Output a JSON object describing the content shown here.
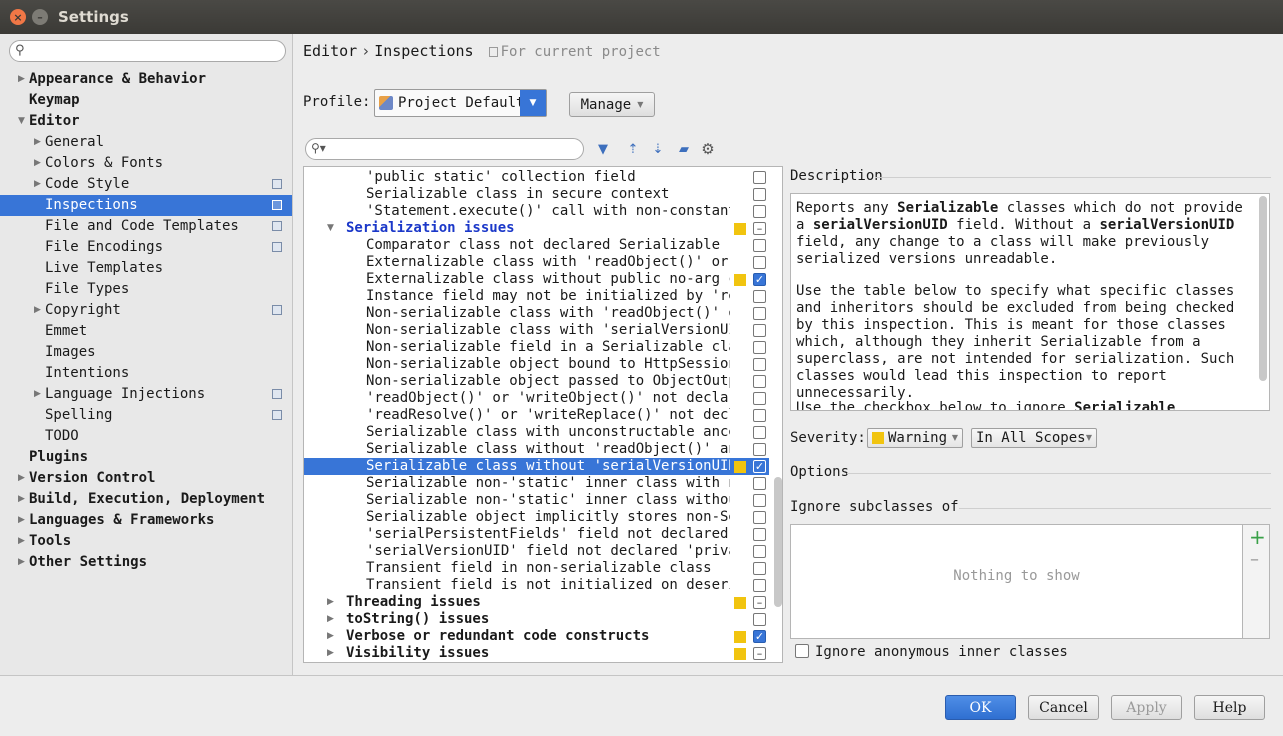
{
  "window": {
    "title": "Settings"
  },
  "sidebar": {
    "search_placeholder": "",
    "tree": [
      {
        "label": "Appearance & Behavior",
        "level": 0,
        "bold": true,
        "arrow": "right"
      },
      {
        "label": "Keymap",
        "level": 0,
        "bold": true,
        "arrow": ""
      },
      {
        "label": "Editor",
        "level": 0,
        "bold": true,
        "arrow": "down"
      },
      {
        "label": "General",
        "level": 1,
        "bold": false,
        "arrow": "right"
      },
      {
        "label": "Colors & Fonts",
        "level": 1,
        "bold": false,
        "arrow": "right"
      },
      {
        "label": "Code Style",
        "level": 1,
        "bold": false,
        "arrow": "right",
        "copy": true
      },
      {
        "label": "Inspections",
        "level": 1,
        "bold": false,
        "arrow": "",
        "copy": true,
        "selected": true
      },
      {
        "label": "File and Code Templates",
        "level": 1,
        "bold": false,
        "arrow": "",
        "copy": true
      },
      {
        "label": "File Encodings",
        "level": 1,
        "bold": false,
        "arrow": "",
        "copy": true
      },
      {
        "label": "Live Templates",
        "level": 1,
        "bold": false,
        "arrow": ""
      },
      {
        "label": "File Types",
        "level": 1,
        "bold": false,
        "arrow": ""
      },
      {
        "label": "Copyright",
        "level": 1,
        "bold": false,
        "arrow": "right",
        "copy": true
      },
      {
        "label": "Emmet",
        "level": 1,
        "bold": false,
        "arrow": ""
      },
      {
        "label": "Images",
        "level": 1,
        "bold": false,
        "arrow": ""
      },
      {
        "label": "Intentions",
        "level": 1,
        "bold": false,
        "arrow": ""
      },
      {
        "label": "Language Injections",
        "level": 1,
        "bold": false,
        "arrow": "right",
        "copy": true
      },
      {
        "label": "Spelling",
        "level": 1,
        "bold": false,
        "arrow": "",
        "copy": true
      },
      {
        "label": "TODO",
        "level": 1,
        "bold": false,
        "arrow": ""
      },
      {
        "label": "Plugins",
        "level": 0,
        "bold": true,
        "arrow": ""
      },
      {
        "label": "Version Control",
        "level": 0,
        "bold": true,
        "arrow": "right"
      },
      {
        "label": "Build, Execution, Deployment",
        "level": 0,
        "bold": true,
        "arrow": "right"
      },
      {
        "label": "Languages & Frameworks",
        "level": 0,
        "bold": true,
        "arrow": "right"
      },
      {
        "label": "Tools",
        "level": 0,
        "bold": true,
        "arrow": "right"
      },
      {
        "label": "Other Settings",
        "level": 0,
        "bold": true,
        "arrow": "right"
      }
    ]
  },
  "header": {
    "crumb1": "Editor",
    "sep": "›",
    "crumb2": "Inspections",
    "scope": "For current project"
  },
  "profile": {
    "label": "Profile:",
    "value": "Project Default",
    "manage": "Manage"
  },
  "inspections": [
    {
      "text": "'public static' collection field",
      "indent": 2,
      "cb": "empty"
    },
    {
      "text": "Serializable class in secure context",
      "indent": 2,
      "cb": "empty"
    },
    {
      "text": "'Statement.execute()' call with non-constant s",
      "indent": 2,
      "cb": "empty"
    },
    {
      "text": "Serialization issues",
      "indent": 1,
      "kind": "blue",
      "arrow": "down",
      "sev": "yellow",
      "cb": "partial"
    },
    {
      "text": "Comparator class not declared Serializable",
      "indent": 2,
      "cb": "empty"
    },
    {
      "text": "Externalizable class with 'readObject()' or 'w",
      "indent": 2,
      "cb": "empty"
    },
    {
      "text": "Externalizable class without public no-arg con",
      "indent": 2,
      "sev": "yellow",
      "cb": "checked"
    },
    {
      "text": "Instance field may not be initialized by 'read",
      "indent": 2,
      "cb": "empty"
    },
    {
      "text": "Non-serializable class with 'readObject()' or",
      "indent": 2,
      "cb": "empty"
    },
    {
      "text": "Non-serializable class with 'serialVersionUID'",
      "indent": 2,
      "cb": "empty"
    },
    {
      "text": "Non-serializable field in a Serializable class",
      "indent": 2,
      "cb": "empty"
    },
    {
      "text": "Non-serializable object bound to HttpSession",
      "indent": 2,
      "cb": "empty"
    },
    {
      "text": "Non-serializable object passed to ObjectOutpu",
      "indent": 2,
      "cb": "empty"
    },
    {
      "text": "'readObject()' or 'writeObject()' not declared",
      "indent": 2,
      "cb": "empty"
    },
    {
      "text": "'readResolve()' or 'writeReplace()' not decla",
      "indent": 2,
      "cb": "empty"
    },
    {
      "text": "Serializable class with unconstructable ancest",
      "indent": 2,
      "cb": "empty"
    },
    {
      "text": "Serializable class without 'readObject()' and",
      "indent": 2,
      "cb": "empty"
    },
    {
      "text": "Serializable class without 'serialVersionUID'",
      "indent": 2,
      "sev": "yellow",
      "cb": "checked",
      "selected": true
    },
    {
      "text": "Serializable non-'static' inner class with non",
      "indent": 2,
      "cb": "empty"
    },
    {
      "text": "Serializable non-'static' inner class without",
      "indent": 2,
      "cb": "empty"
    },
    {
      "text": "Serializable object implicitly stores non-Ser",
      "indent": 2,
      "cb": "empty"
    },
    {
      "text": "'serialPersistentFields' field not declared 'p",
      "indent": 2,
      "cb": "empty"
    },
    {
      "text": "'serialVersionUID' field not declared 'private",
      "indent": 2,
      "cb": "empty"
    },
    {
      "text": "Transient field in non-serializable class",
      "indent": 2,
      "cb": "empty"
    },
    {
      "text": "Transient field is not initialized on deseria",
      "indent": 2,
      "cb": "empty"
    },
    {
      "text": "Threading issues",
      "indent": 1,
      "kind": "group",
      "arrow": "right",
      "sev": "yellow",
      "cb": "partial"
    },
    {
      "text": "toString() issues",
      "indent": 1,
      "kind": "group",
      "arrow": "right",
      "cb": "empty"
    },
    {
      "text": "Verbose or redundant code constructs",
      "indent": 1,
      "kind": "group",
      "arrow": "right",
      "sev": "yellow",
      "cb": "checked"
    },
    {
      "text": "Visibility issues",
      "indent": 1,
      "kind": "group",
      "arrow": "right",
      "sev": "yellow",
      "cb": "partial"
    }
  ],
  "description": {
    "header": "Description",
    "p1_a": "Reports any ",
    "p1_b": "Serializable",
    "p1_c": " classes which do not provide a ",
    "p1_d": "serialVersionUID",
    "p1_e": " field. Without a ",
    "p1_f": "serialVersionUID",
    "p1_g": " field, any change to a class will make previously serialized versions unreadable.",
    "p2": "Use the table below to specify what specific classes and inheritors should be excluded from being checked by this inspection. This is meant for those classes which, although they inherit Serializable from a superclass, are not intended for serialization. Such classes would lead this inspection to report unnecessarily.",
    "p3_a": "Use the checkbox below to ignore ",
    "p3_b": "Serializable"
  },
  "severity": {
    "label": "Severity:",
    "value": "Warning",
    "scope": "In All Scopes"
  },
  "options": {
    "label": "Options",
    "ignore_label": "Ignore subclasses of",
    "empty": "Nothing to show",
    "anon": "Ignore anonymous inner classes"
  },
  "buttons": {
    "ok": "OK",
    "cancel": "Cancel",
    "apply": "Apply",
    "help": "Help"
  },
  "colors": {
    "accent": "#3875d7",
    "warning": "#f1c40f"
  }
}
